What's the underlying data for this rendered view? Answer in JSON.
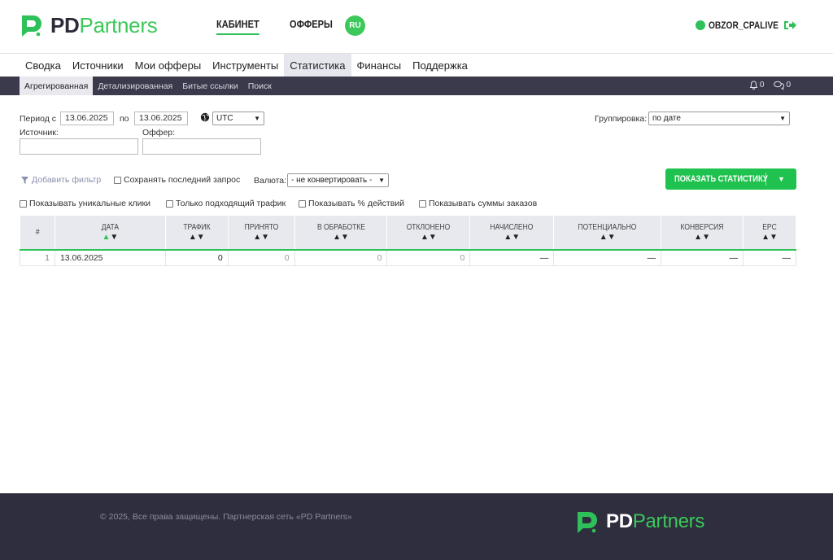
{
  "header": {
    "brand_pd": "PD",
    "brand_partners": "Partners",
    "nav": [
      {
        "label": "КАБИНЕТ",
        "active": true
      },
      {
        "label": "ОФФЕРЫ",
        "active": false
      }
    ],
    "lang": "RU",
    "username": "OBZOR_CPALIVE"
  },
  "main_nav": [
    {
      "label": "Сводка"
    },
    {
      "label": "Источники"
    },
    {
      "label": "Мои офферы"
    },
    {
      "label": "Инструменты"
    },
    {
      "label": "Статистика",
      "active": true
    },
    {
      "label": "Финансы"
    },
    {
      "label": "Поддержка"
    }
  ],
  "sub_nav": [
    {
      "label": "Агрегированная",
      "active": true
    },
    {
      "label": "Детализированная"
    },
    {
      "label": "Битые ссылки"
    },
    {
      "label": "Поиск"
    }
  ],
  "notifications": {
    "bell_count": "0",
    "messages_count": "0"
  },
  "filters": {
    "period_from_label": "Период с",
    "period_from": "13.06.2025",
    "period_to_label": "по",
    "period_to": "13.06.2025",
    "timezone": "UTC",
    "source_label": "Источник:",
    "source_value": "",
    "offer_label": "Оффер:",
    "offer_value": "",
    "grouping_label": "Группировка:",
    "grouping_value": "по дате",
    "add_filter": "Добавить фильтр",
    "save_last_query": "Сохранять последний запрос",
    "currency_label": "Валюта:",
    "currency_value": "- не конвертировать -",
    "show_unique_clicks": "Показывать уникальные клики",
    "only_matching_traffic": "Только подходящий трафик",
    "show_action_percent": "Показывать % действий",
    "show_order_sums": "Показывать суммы заказов",
    "show_stats_button": "ПОКАЗАТЬ СТАТИСТИКУ"
  },
  "table": {
    "columns": [
      "#",
      "ДАТА",
      "ТРАФИК",
      "ПРИНЯТО",
      "В ОБРАБОТКЕ",
      "ОТКЛОНЕНО",
      "НАЧИСЛЕНО",
      "ПОТЕНЦИАЛЬНО",
      "КОНВЕРСИЯ",
      "EPC"
    ],
    "rows": [
      [
        "1",
        "13.06.2025",
        "0",
        "0",
        "0",
        "0",
        "—",
        "—",
        "—",
        "—"
      ]
    ]
  },
  "footer": {
    "copyright": "© 2025, Все права защищены. Партнерская сеть «PD Partners»",
    "brand_pd": "PD",
    "brand_partners": "Partners"
  },
  "colors": {
    "accent": "#2fc159",
    "dark": "#3a3a4c",
    "footer": "#2e2e3e"
  }
}
